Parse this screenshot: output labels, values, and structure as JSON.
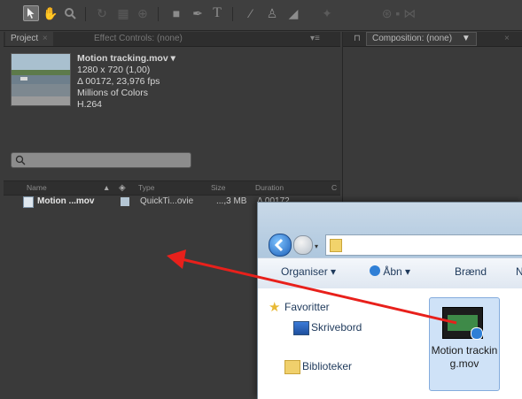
{
  "toolbar": {
    "tools": [
      "selection-tool",
      "hand-tool",
      "zoom-tool",
      "rotate-tool",
      "camera-tool",
      "pan-behind-tool",
      "rectangle-tool",
      "pen-tool",
      "text-tool",
      "brush-tool",
      "clone-stamp-tool",
      "eraser-tool",
      "roto-brush-tool",
      "puppet-tool"
    ]
  },
  "project_panel": {
    "tab_label": "Project",
    "effect_tab_label": "Effect Controls: (none)",
    "item": {
      "name": "Motion tracking.mov",
      "resolution": "1280 x 720 (1,00)",
      "duration_fps": "Δ 00172, 23,976 fps",
      "colors": "Millions of Colors",
      "codec": "H.264"
    },
    "columns": {
      "name": "Name",
      "type": "Type",
      "size": "Size",
      "duration": "Duration",
      "extra": "C"
    },
    "row": {
      "name": "Motion ...mov",
      "type": "QuickTi...ovie",
      "size": "...,3 MB",
      "duration": "Δ 00172"
    }
  },
  "comp_panel": {
    "label": "Composition: (none)"
  },
  "explorer": {
    "commands": {
      "organize": "Organiser",
      "open": "Åbn",
      "burn": "Brænd",
      "more": "N"
    },
    "nav": {
      "favorites": "Favoritter",
      "desktop": "Skrivebord",
      "libraries": "Biblioteker"
    },
    "file": {
      "name": "Motion tracking.mov"
    }
  },
  "colors": {
    "arrow": "#e8201b",
    "panel_bg": "#3a3a3a",
    "explorer_accent": "#1e395b"
  }
}
